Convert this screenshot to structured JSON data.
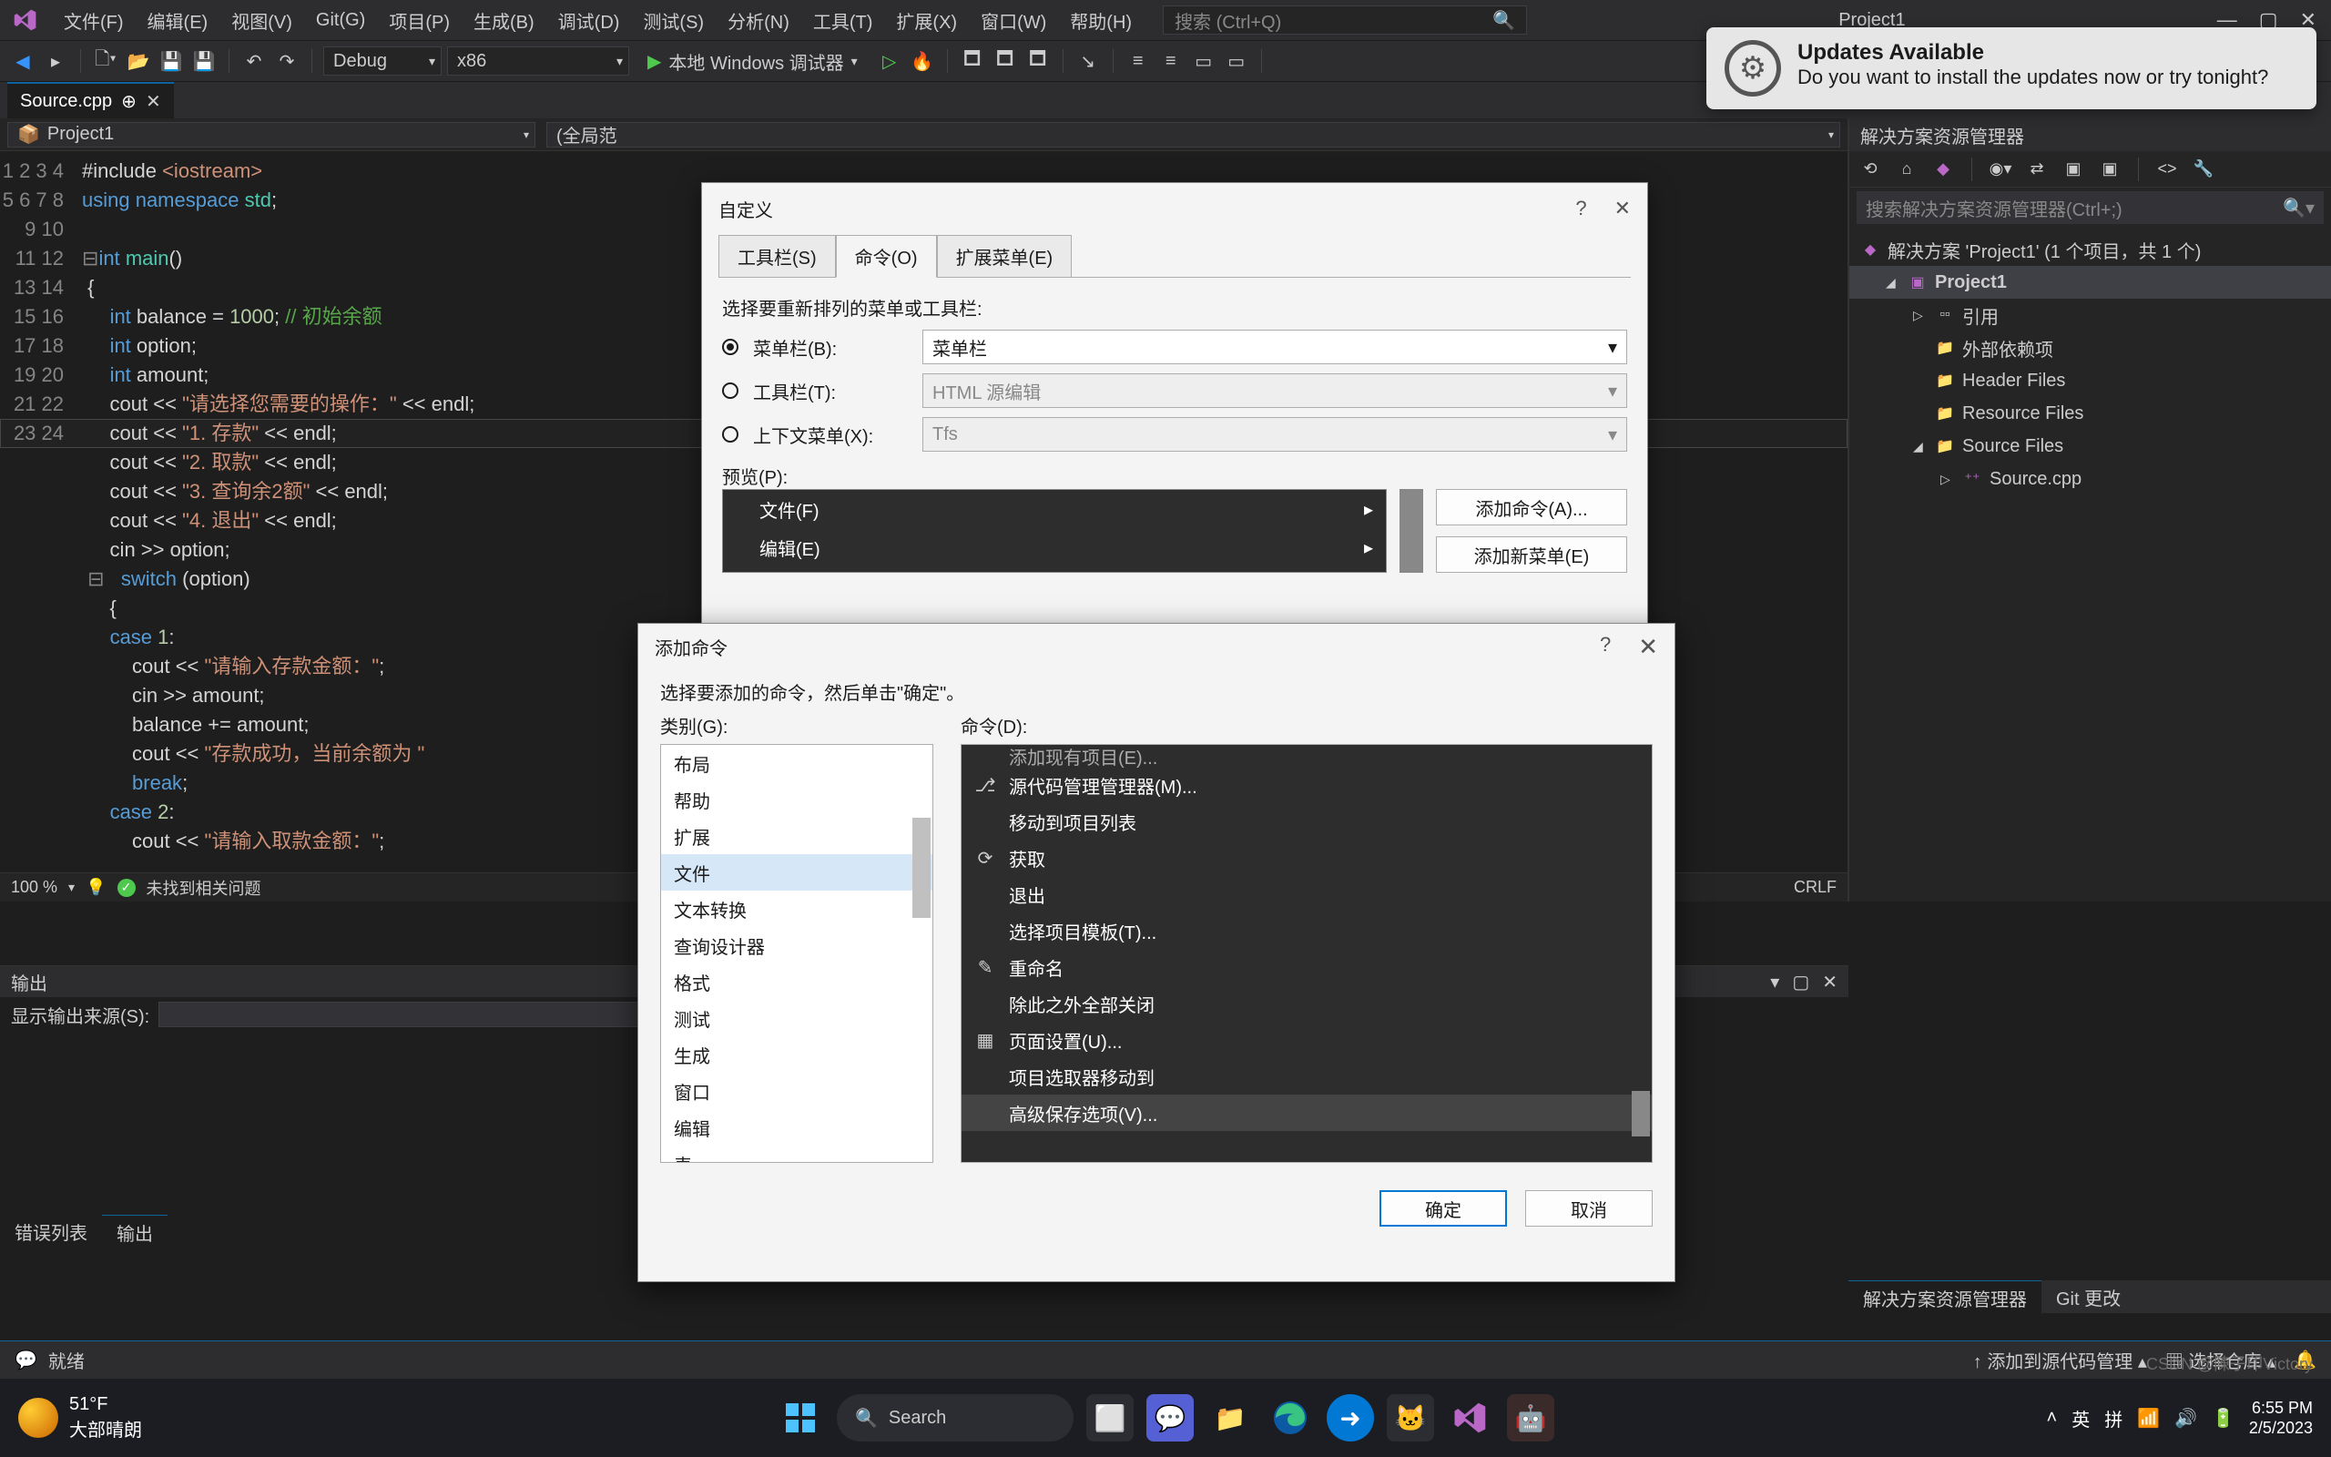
{
  "menubar": {
    "items": [
      "文件(F)",
      "编辑(E)",
      "视图(V)",
      "Git(G)",
      "项目(P)",
      "生成(B)",
      "调试(D)",
      "测试(S)",
      "分析(N)",
      "工具(T)",
      "扩展(X)",
      "窗口(W)",
      "帮助(H)"
    ],
    "search_placeholder": "搜索 (Ctrl+Q)",
    "project_title": "Project1"
  },
  "toolbar": {
    "config": "Debug",
    "platform": "x86",
    "debug_btn": "本地 Windows 调试器"
  },
  "tab": {
    "name": "Source.cpp"
  },
  "editor": {
    "nav_left": "Project1",
    "nav_mid": "(全局范",
    "line_numbers": [
      "1",
      "2",
      "3",
      "4",
      "5",
      "6",
      "7",
      "8",
      "9",
      "10",
      "11",
      "12",
      "13",
      "14",
      "15",
      "16",
      "17",
      "18",
      "19",
      "20",
      "21",
      "22",
      "23",
      "24"
    ],
    "highlight_line_index": 9,
    "status_zoom": "100 %",
    "status_msg": "未找到相关问题",
    "status_crlf": "CRLF"
  },
  "solution": {
    "title": "解决方案资源管理器",
    "search_placeholder": "搜索解决方案资源管理器(Ctrl+;)",
    "root": "解决方案 'Project1' (1 个项目，共 1 个)",
    "project": "Project1",
    "nodes": [
      "引用",
      "外部依赖项",
      "Header Files",
      "Resource Files",
      "Source Files"
    ],
    "source_file": "Source.cpp",
    "bottom_tabs": [
      "解决方案资源管理器",
      "Git 更改"
    ]
  },
  "output": {
    "title": "输出",
    "label": "显示输出来源(S):",
    "tabs": [
      "错误列表",
      "输出"
    ]
  },
  "ide_status": {
    "ready": "就绪",
    "add_source": "添加到源代码管理",
    "select_repo": "选择仓库"
  },
  "dlg_customize": {
    "title": "自定义",
    "tabs": [
      "工具栏(S)",
      "命令(O)",
      "扩展菜单(E)"
    ],
    "active_tab": 1,
    "instruction": "选择要重新排列的菜单或工具栏:",
    "rows": [
      {
        "label": "菜单栏(B):",
        "value": "菜单栏",
        "checked": true,
        "dim": false
      },
      {
        "label": "工具栏(T):",
        "value": "HTML 源编辑",
        "checked": false,
        "dim": true
      },
      {
        "label": "上下文菜单(X):",
        "value": "Tfs",
        "checked": false,
        "dim": true
      }
    ],
    "preview_label": "预览(P):",
    "preview_items": [
      "文件(F)",
      "编辑(E)"
    ],
    "buttons": [
      "添加命令(A)...",
      "添加新菜单(E)"
    ]
  },
  "dlg_addcmd": {
    "title": "添加命令",
    "instruction": "选择要添加的命令，然后单击\"确定\"。",
    "cat_label": "类别(G):",
    "cmd_label": "命令(D):",
    "categories": [
      "布局",
      "帮助",
      "扩展",
      "文件",
      "文本转换",
      "查询设计器",
      "格式",
      "测试",
      "生成",
      "窗口",
      "编辑",
      "表"
    ],
    "cat_selected": 3,
    "commands": [
      "添加现有项目(E)...",
      "源代码管理管理器(M)...",
      "移动到项目列表",
      "获取",
      "退出",
      "选择项目模板(T)...",
      "重命名",
      "除此之外全部关闭",
      "页面设置(U)...",
      "项目选取器移动到",
      "高级保存选项(V)..."
    ],
    "ok": "确定",
    "cancel": "取消"
  },
  "toast": {
    "title": "Updates Available",
    "body": "Do you want to install the updates now or try tonight?"
  },
  "taskbar": {
    "temp": "51°F",
    "weather": "大部晴朗",
    "search": "Search",
    "ime1": "英",
    "ime2": "拼",
    "time": "6:55 PM",
    "date": "2/5/2023"
  },
  "watermark": "CSDN @陳子印Victory"
}
